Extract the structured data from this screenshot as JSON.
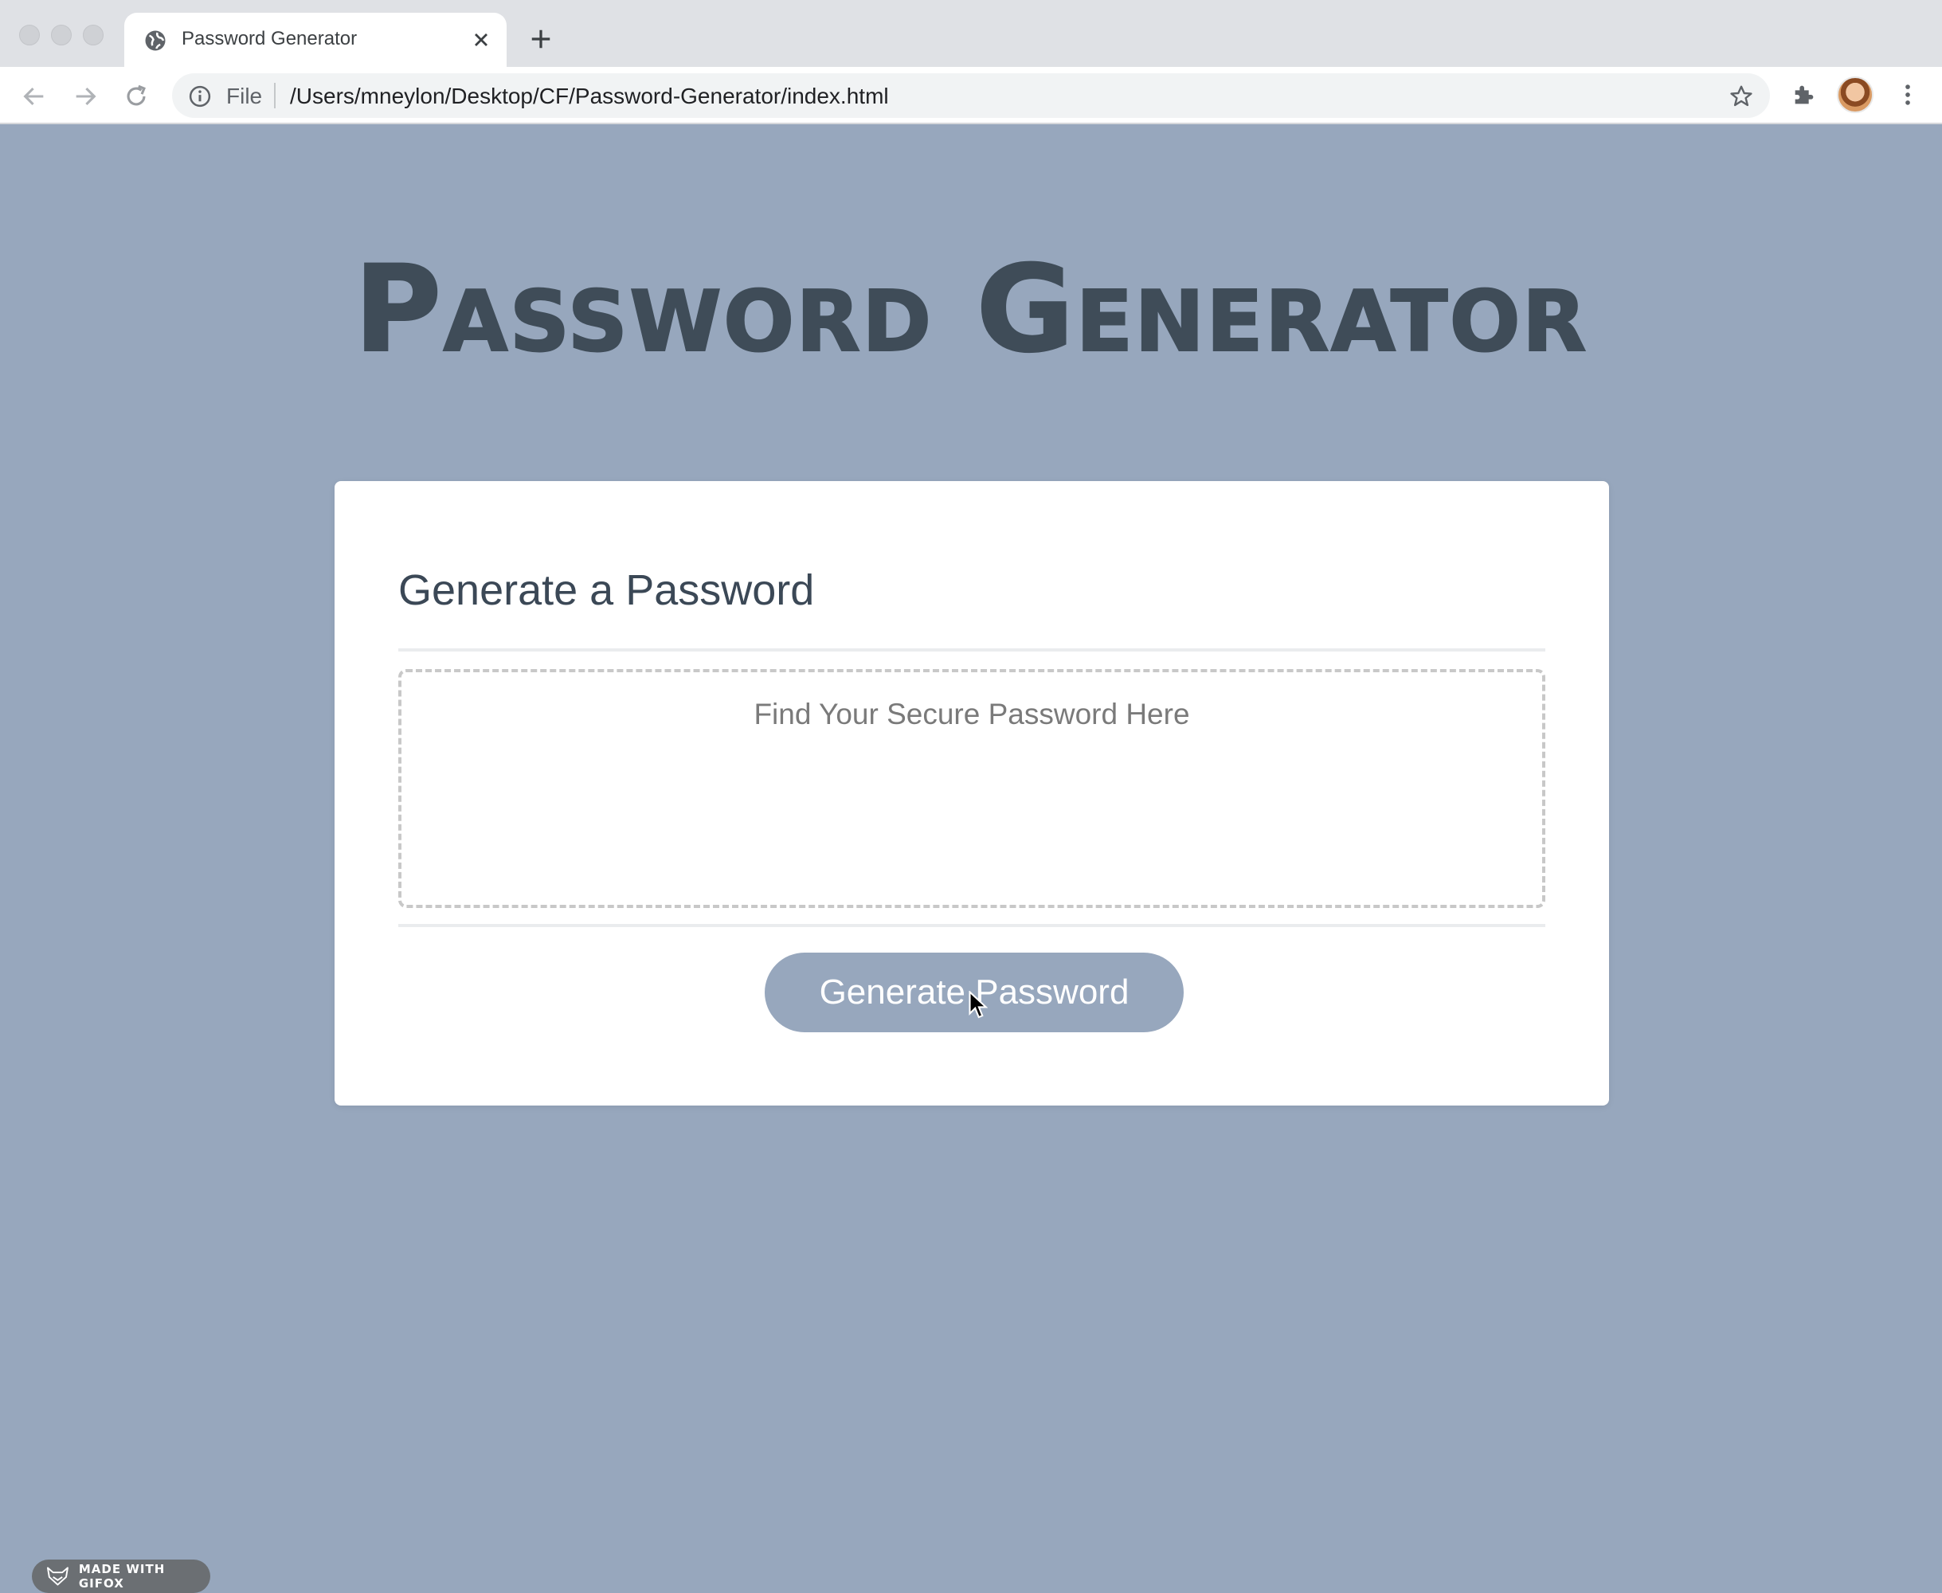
{
  "browser": {
    "tab_title": "Password Generator",
    "omnibox_scheme": "File",
    "omnibox_url": "/Users/mneylon/Desktop/CF/Password-Generator/index.html",
    "icons": [
      "globe-icon",
      "close-icon",
      "plus-icon",
      "back-icon",
      "forward-icon",
      "reload-icon",
      "info-icon",
      "star-icon",
      "puzzle-icon",
      "kebab-menu-icon"
    ]
  },
  "page": {
    "title": "Password Generator",
    "card_heading": "Generate a Password",
    "password_placeholder": "Find Your Secure Password Here",
    "password_value": "",
    "generate_button_label": "Generate Password"
  },
  "badge": {
    "text": "MADE WITH GIFOX"
  },
  "colors": {
    "page_background": "#97a7bd",
    "title_color": "#3f4c58",
    "button_color": "#97a7bd",
    "card_background": "#ffffff"
  }
}
